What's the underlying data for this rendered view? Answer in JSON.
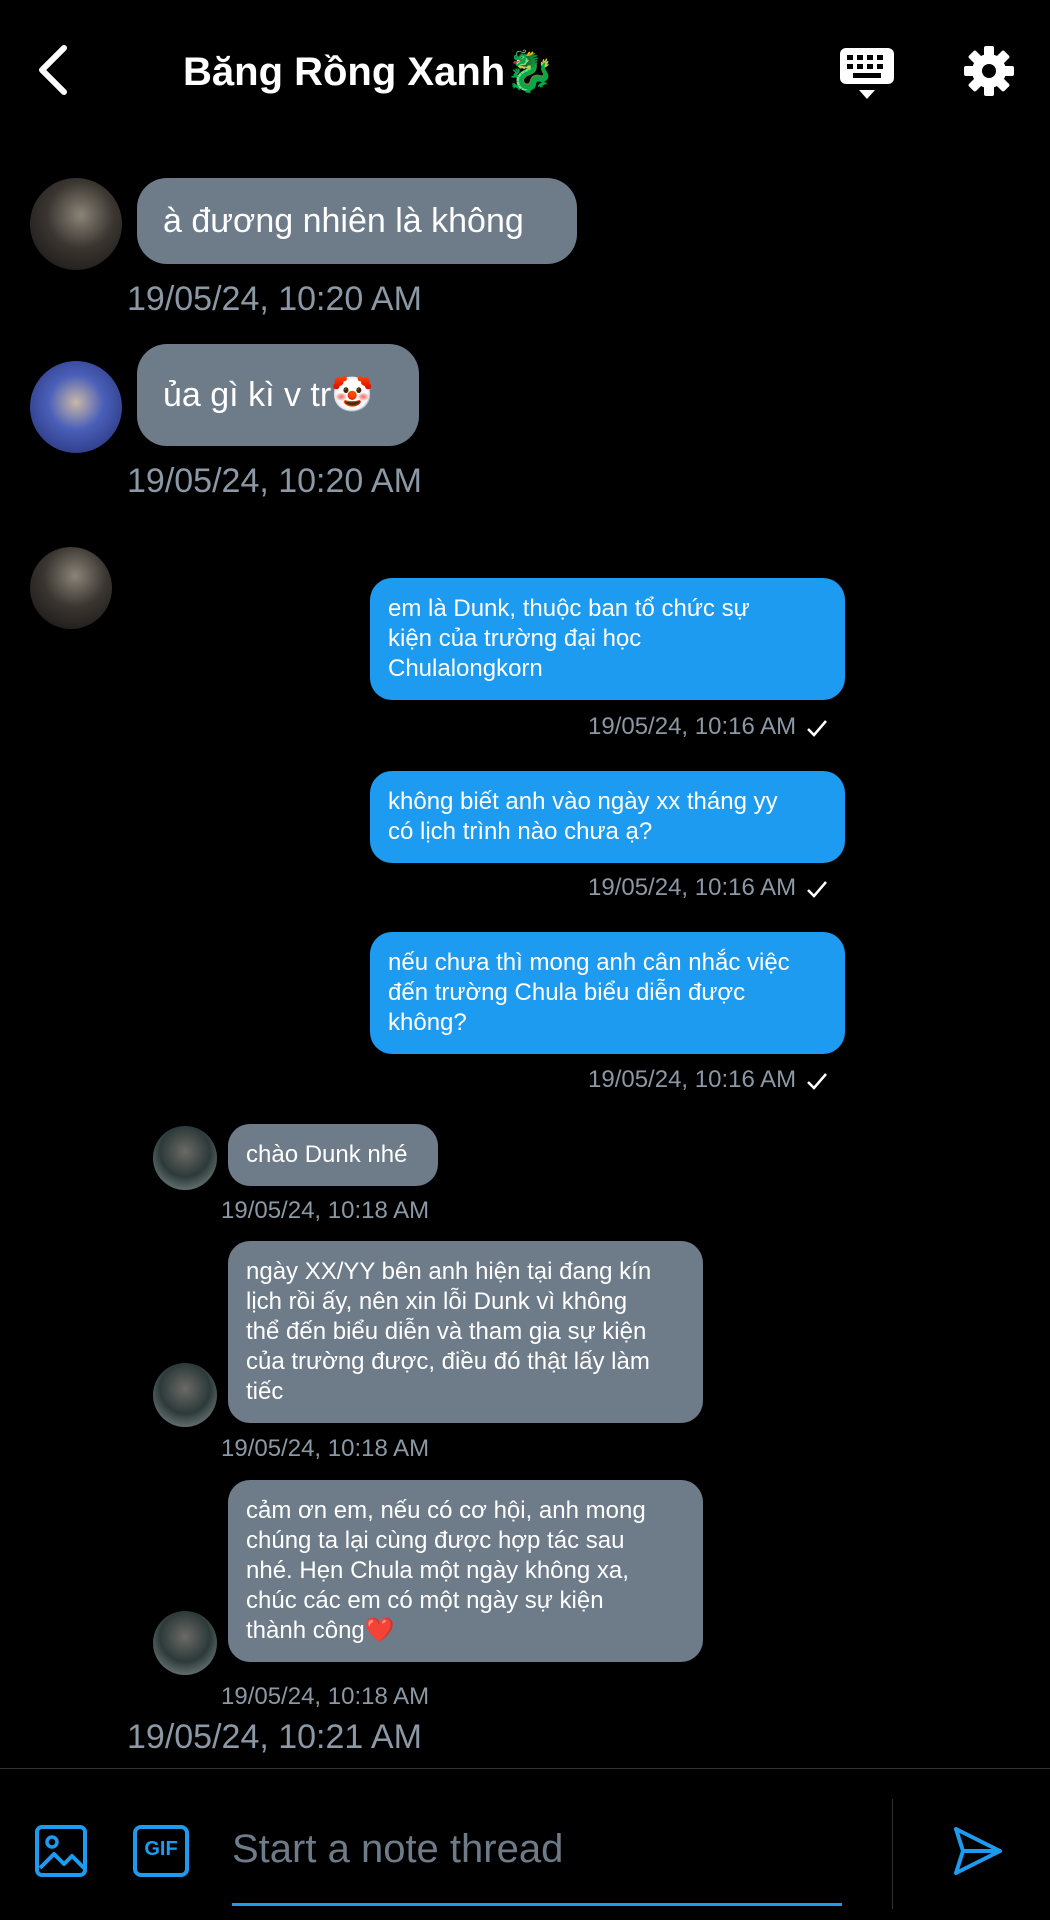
{
  "header": {
    "title": "Băng Rồng Xanh🐉"
  },
  "messages": [
    {
      "text": "à đương nhiên là không",
      "time": "19/05/24, 10:20 AM"
    },
    {
      "text": "ủa gì kì v tr🤡",
      "time": "19/05/24, 10:20 AM"
    },
    {
      "text": "em là Dunk, thuộc ban tổ chức sự\nkiện của trường đại học\nChulalongkorn",
      "time": "19/05/24, 10:16 AM"
    },
    {
      "text": "không biết anh vào ngày xx tháng yy\ncó lịch trình nào chưa ạ?",
      "time": "19/05/24, 10:16 AM"
    },
    {
      "text": "nếu chưa thì mong anh cân nhắc việc\nđến trường Chula biểu diễn được\nkhông?",
      "time": "19/05/24, 10:16 AM"
    },
    {
      "text": "chào Dunk nhé",
      "time": "19/05/24, 10:18 AM"
    },
    {
      "text": "ngày XX/YY bên anh hiện tại đang kín\nlịch rồi ấy, nên xin lỗi Dunk vì không\nthể đến biểu diễn và tham gia sự kiện\ncủa trường được, điều đó thật lấy làm\ntiếc",
      "time": "19/05/24, 10:18 AM"
    },
    {
      "text": "cảm ơn em, nếu có cơ hội, anh mong\nchúng ta lại cùng được hợp tác sau\nnhé. Hẹn Chula một ngày không xa,\nchúc các em có một ngày sự kiện\nthành công❤️",
      "time": "19/05/24, 10:18 AM"
    }
  ],
  "footer_time": "19/05/24, 10:21 AM",
  "composer": {
    "placeholder": "Start a note thread",
    "gif_label": "GIF"
  },
  "colors": {
    "accent": "#1d9bf0",
    "bubble_gray": "#6e7b89",
    "timestamp": "#8b98a5"
  },
  "icons": [
    "back-arrow-icon",
    "keyboard-icon",
    "gear-icon",
    "image-icon",
    "gif-icon",
    "send-icon"
  ]
}
